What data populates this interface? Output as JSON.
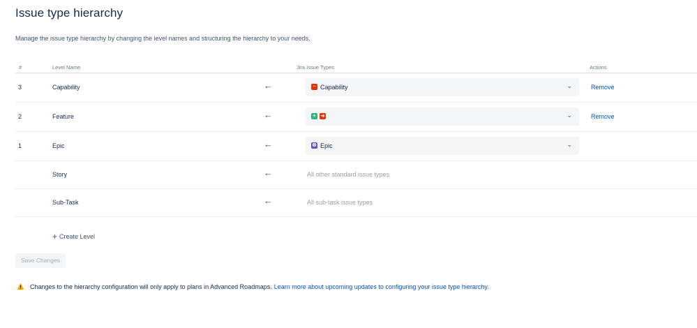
{
  "title": "Issue type hierarchy",
  "description": "Manage the issue type hierarchy by changing the level names and structuring the hierarchy to your needs.",
  "table": {
    "headers": {
      "num": "#",
      "name": "Level Name",
      "types": "Jira Issue Types",
      "actions": "Actions"
    },
    "rows": [
      {
        "num": "3",
        "name": "Capability",
        "arrow": "←",
        "type_label": "Capability",
        "icons": [
          "capability-icon"
        ],
        "icon_colors": [
          "#de350b"
        ],
        "action": "Remove"
      },
      {
        "num": "2",
        "name": "Feature",
        "arrow": "←",
        "type_label": "",
        "icons": [
          "plus-square-icon",
          "arrow-square-icon"
        ],
        "icon_colors": [
          "#36b37e",
          "#de350b"
        ],
        "action": "Remove"
      },
      {
        "num": "1",
        "name": "Epic",
        "arrow": "←",
        "type_label": "Epic",
        "icons": [
          "epic-bolt-icon"
        ],
        "icon_colors": [
          "#6554c0"
        ],
        "action": ""
      },
      {
        "num": "",
        "name": "Story",
        "arrow": "←",
        "muted_text": "All other standard issue types"
      },
      {
        "num": "",
        "name": "Sub-Task",
        "arrow": "←",
        "muted_text": "All sub-task issue types"
      }
    ]
  },
  "create_level": "Create Level",
  "save_button": "Save Changes",
  "warning": {
    "text": "Changes to the hierarchy configuration will only apply to plans in Advanced Roadmaps.",
    "link": "Learn more about upcoming updates to configuring your issue type hierarchy."
  },
  "colors": {
    "link": "#0052cc",
    "warning": "#ffab00"
  }
}
